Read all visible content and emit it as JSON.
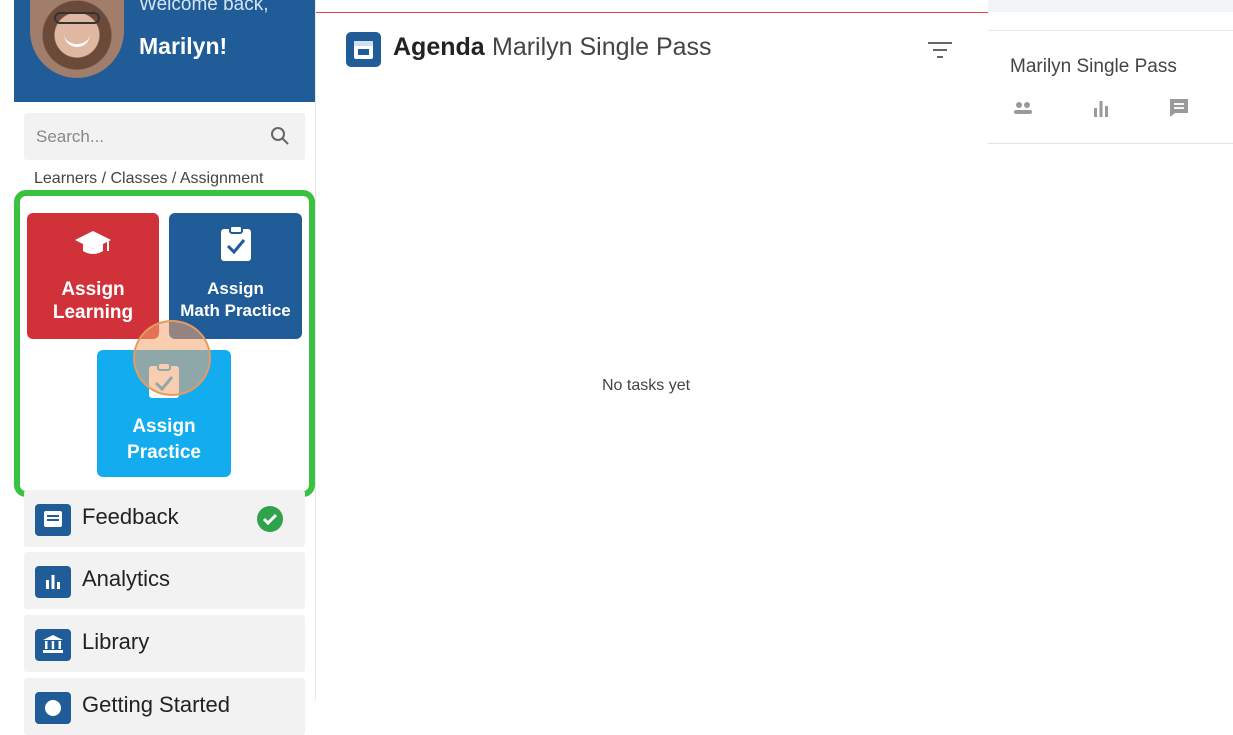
{
  "header": {
    "welcome_prefix": "Welcome back,",
    "user_name": "Marilyn!"
  },
  "search": {
    "placeholder": "Search...",
    "value": ""
  },
  "breadcrumb": "Learners / Classes / Assignment",
  "assign_tiles": {
    "learning": {
      "line1": "Assign",
      "line2": "Learning",
      "color": "#d13239",
      "icon": "graduation-cap-icon"
    },
    "math": {
      "line1": "Assign",
      "line2": "Math Practice",
      "color": "#1f5c98",
      "icon": "clipboard-check-icon"
    },
    "practice": {
      "line1": "Assign",
      "line2": "Practice",
      "color": "#13acef",
      "icon": "clipboard-check-icon"
    }
  },
  "nav": [
    {
      "label": "Feedback",
      "icon": "feedback-icon",
      "status": "check"
    },
    {
      "label": "Analytics",
      "icon": "analytics-icon"
    },
    {
      "label": "Library",
      "icon": "library-icon"
    },
    {
      "label": "Getting Started",
      "icon": "help-icon"
    }
  ],
  "agenda": {
    "title": "Agenda",
    "subtitle": "Marilyn Single Pass",
    "empty_message": "No tasks yet"
  },
  "right_panel": {
    "title": "Marilyn Single Pass",
    "icons": [
      "people-icon",
      "bar-chart-icon",
      "comment-icon"
    ]
  },
  "colors": {
    "brand_blue": "#1f5c98",
    "highlight_green": "#38c23f",
    "success_green": "#2fa24a",
    "top_line_red": "#d9463e"
  }
}
